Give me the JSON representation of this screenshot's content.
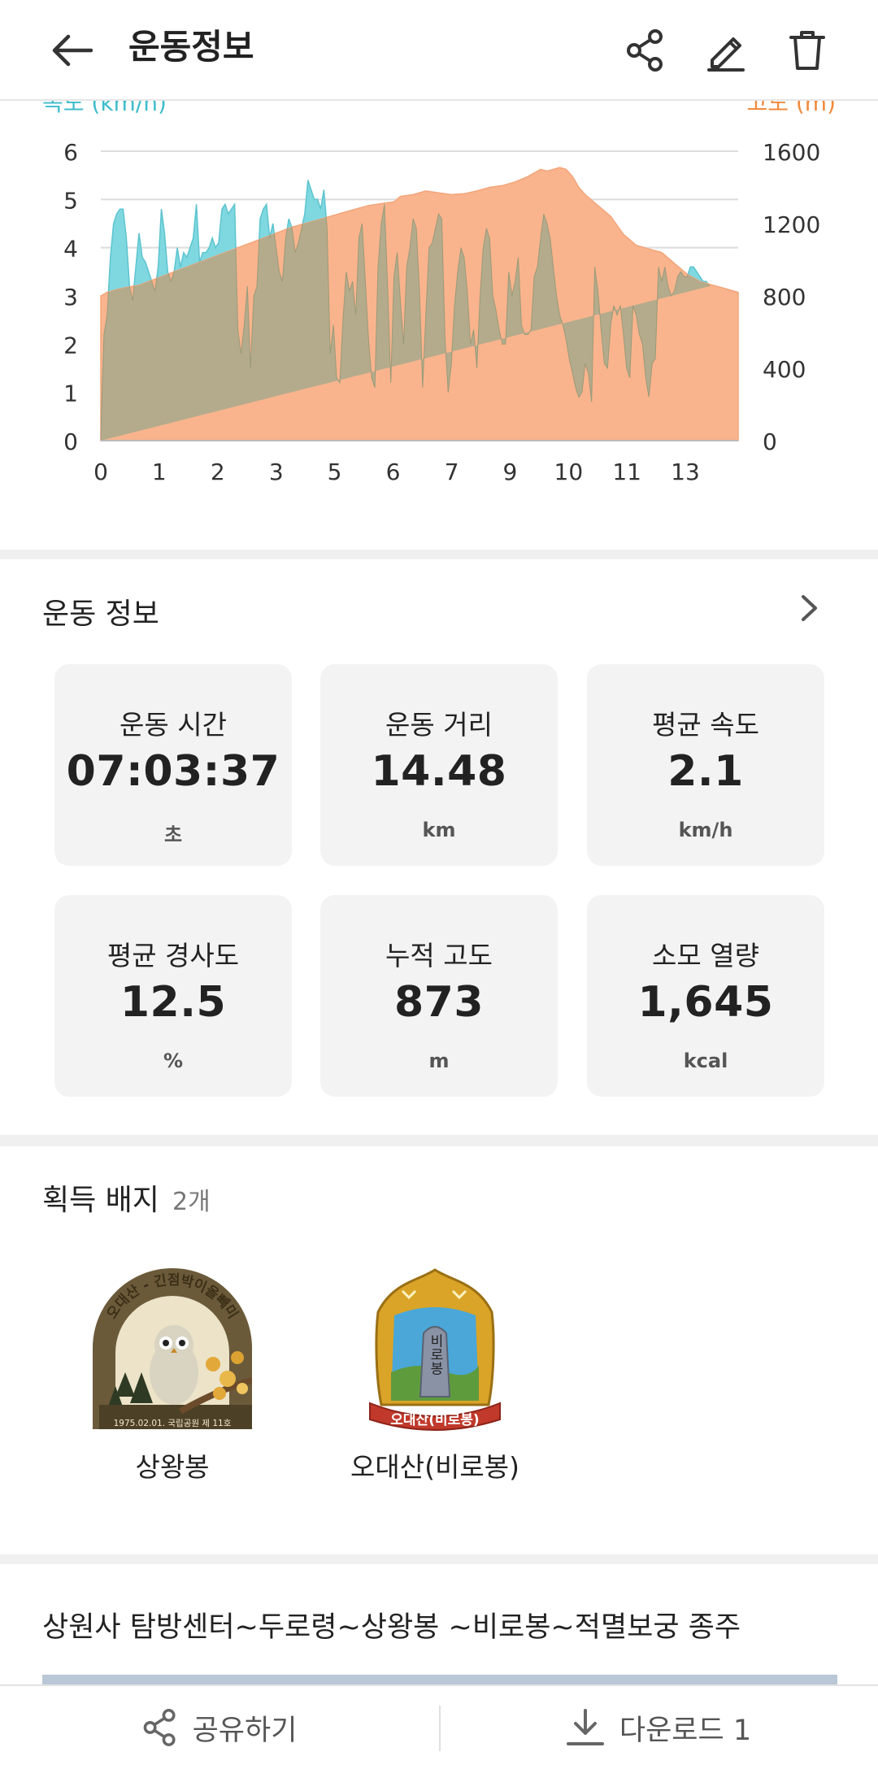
{
  "header": {
    "title": "운동정보",
    "icons": [
      "back-arrow-icon",
      "share-icon",
      "edit-icon",
      "trash-icon"
    ]
  },
  "chart_data": {
    "type": "area",
    "left_axis_label": "속도 (km/h)",
    "right_axis_label": "고도 (m)",
    "x_ticks": [
      "0",
      "1",
      "2",
      "3",
      "5",
      "6",
      "7",
      "9",
      "10",
      "11",
      "13"
    ],
    "x_tick_fracs": [
      0,
      0.0915,
      0.1834,
      0.2752,
      0.3667,
      0.4586,
      0.5506,
      0.6421,
      0.7339,
      0.8255,
      0.9171
    ],
    "y_left_ticks": [
      0,
      1,
      2,
      3,
      4,
      5,
      6
    ],
    "y_right_ticks": [
      0,
      400,
      800,
      1200,
      1600
    ],
    "ylim_left": [
      0,
      6
    ],
    "ylim_right": [
      0,
      1600
    ],
    "colors": {
      "speed": "#7fd8e0",
      "altitude": "#f9b48d",
      "overlap": "#b4ab8c"
    },
    "series": [
      {
        "name": "고도 (m)",
        "axis": "right",
        "x_frac": [
          0,
          0.01,
          0.03,
          0.06,
          0.09,
          0.12,
          0.15,
          0.18,
          0.21,
          0.24,
          0.27,
          0.3,
          0.33,
          0.36,
          0.39,
          0.42,
          0.44,
          0.46,
          0.47,
          0.49,
          0.51,
          0.53,
          0.55,
          0.57,
          0.59,
          0.61,
          0.63,
          0.65,
          0.67,
          0.69,
          0.7,
          0.71,
          0.72,
          0.73,
          0.74,
          0.75,
          0.76,
          0.78,
          0.8,
          0.82,
          0.84,
          0.86,
          0.88,
          0.9,
          0.92,
          0.94,
          0.96,
          0.98,
          1.0
        ],
        "values": [
          800,
          820,
          840,
          860,
          900,
          940,
          980,
          1020,
          1060,
          1100,
          1140,
          1180,
          1210,
          1240,
          1270,
          1300,
          1310,
          1320,
          1350,
          1360,
          1380,
          1370,
          1360,
          1365,
          1380,
          1400,
          1410,
          1430,
          1460,
          1500,
          1490,
          1500,
          1510,
          1500,
          1460,
          1400,
          1360,
          1300,
          1240,
          1140,
          1080,
          1060,
          1040,
          980,
          920,
          880,
          860,
          840,
          820
        ]
      },
      {
        "name": "속도 (km/h)",
        "axis": "left",
        "x_frac": [
          0,
          0.005,
          0.01,
          0.015,
          0.02,
          0.025,
          0.03,
          0.035,
          0.04,
          0.045,
          0.05,
          0.055,
          0.06,
          0.065,
          0.07,
          0.075,
          0.08,
          0.085,
          0.09,
          0.095,
          0.1,
          0.105,
          0.11,
          0.115,
          0.12,
          0.125,
          0.13,
          0.135,
          0.14,
          0.145,
          0.15,
          0.155,
          0.16,
          0.165,
          0.17,
          0.175,
          0.18,
          0.185,
          0.19,
          0.195,
          0.2,
          0.205,
          0.21,
          0.215,
          0.22,
          0.225,
          0.23,
          0.235,
          0.24,
          0.245,
          0.25,
          0.255,
          0.26,
          0.265,
          0.27,
          0.275,
          0.28,
          0.285,
          0.29,
          0.295,
          0.3,
          0.305,
          0.31,
          0.315,
          0.32,
          0.325,
          0.33,
          0.335,
          0.34,
          0.345,
          0.35,
          0.355,
          0.36,
          0.365,
          0.37,
          0.375,
          0.38,
          0.385,
          0.39,
          0.395,
          0.4,
          0.405,
          0.41,
          0.415,
          0.42,
          0.425,
          0.43,
          0.435,
          0.44,
          0.445,
          0.45,
          0.455,
          0.46,
          0.465,
          0.47,
          0.475,
          0.48,
          0.485,
          0.49,
          0.495,
          0.5,
          0.505,
          0.51,
          0.515,
          0.52,
          0.525,
          0.53,
          0.535,
          0.54,
          0.545,
          0.55,
          0.555,
          0.56,
          0.565,
          0.57,
          0.575,
          0.58,
          0.585,
          0.59,
          0.595,
          0.6,
          0.605,
          0.61,
          0.615,
          0.62,
          0.625,
          0.63,
          0.635,
          0.64,
          0.645,
          0.65,
          0.655,
          0.66,
          0.665,
          0.67,
          0.675,
          0.68,
          0.685,
          0.69,
          0.695,
          0.7,
          0.705,
          0.71,
          0.715,
          0.72,
          0.725,
          0.73,
          0.735,
          0.74,
          0.745,
          0.75,
          0.755,
          0.76,
          0.765,
          0.77,
          0.775,
          0.78,
          0.785,
          0.79,
          0.795,
          0.8,
          0.805,
          0.81,
          0.815,
          0.82,
          0.825,
          0.83,
          0.835,
          0.84,
          0.845,
          0.85,
          0.855,
          0.86,
          0.865,
          0.87,
          0.875,
          0.88,
          0.885,
          0.89,
          0.895,
          0.9,
          0.905,
          0.91,
          0.915,
          0.92,
          0.925,
          0.93,
          0.935,
          0.94,
          0.945,
          0.95,
          0.955,
          0.96,
          0.965,
          0.97,
          0.975,
          0.98,
          0.985,
          0.99,
          0.995,
          1.0
        ],
        "values": [
          0.2,
          2.2,
          2.6,
          3.8,
          4.5,
          4.7,
          4.8,
          4.8,
          4.2,
          3.2,
          2.9,
          3.6,
          4.3,
          3.8,
          3.7,
          3.5,
          3.3,
          3.1,
          3.6,
          4.8,
          4.3,
          3.5,
          3.3,
          3.5,
          4.0,
          3.6,
          3.9,
          3.8,
          4.0,
          4.2,
          4.9,
          3.7,
          3.9,
          3.9,
          4.0,
          4.2,
          4.0,
          4.1,
          4.8,
          4.9,
          4.7,
          4.8,
          4.9,
          2.3,
          1.8,
          2.4,
          3.2,
          1.5,
          3.0,
          3.2,
          4.6,
          4.8,
          4.9,
          4.2,
          4.5,
          4.0,
          3.5,
          3.3,
          4.2,
          4.6,
          4.4,
          3.9,
          4.1,
          4.4,
          4.7,
          5.4,
          5.2,
          5.0,
          5.0,
          4.8,
          5.2,
          4.4,
          1.8,
          2.4,
          1.3,
          1.2,
          2.5,
          3.5,
          3.1,
          3.3,
          2.6,
          4.2,
          4.5,
          3.3,
          2.1,
          1.3,
          1.1,
          3.6,
          4.5,
          4.9,
          3.2,
          1.2,
          3.4,
          3.9,
          2.9,
          2.0,
          3.6,
          4.0,
          4.6,
          4.4,
          3.1,
          1.1,
          2.6,
          4.0,
          4.1,
          4.4,
          4.7,
          4.6,
          2.1,
          1.0,
          1.6,
          2.8,
          3.5,
          4.0,
          3.8,
          3.1,
          2.0,
          2.3,
          1.5,
          3.0,
          4.0,
          4.4,
          4.2,
          3.0,
          2.7,
          2.3,
          2.0,
          2.0,
          3.5,
          3.0,
          3.3,
          3.8,
          2.4,
          2.2,
          2.2,
          2.3,
          3.4,
          3.6,
          4.2,
          4.7,
          4.5,
          4.2,
          3.6,
          3.0,
          2.6,
          2.4,
          2.1,
          1.7,
          1.4,
          1.1,
          0.9,
          1.0,
          1.6,
          1.4,
          0.8,
          3.6,
          3.1,
          2.3,
          1.6,
          1.5,
          2.4,
          2.8,
          2.6,
          2.8,
          2.2,
          1.5,
          1.3,
          2.8,
          2.6,
          2.2,
          2.0,
          1.3,
          0.9,
          1.6,
          1.7,
          3.6,
          3.3,
          3.6,
          3.2,
          3.0,
          3.1,
          3.4,
          3.5,
          3.4,
          3.4,
          3.6,
          3.6,
          3.5,
          3.4,
          3.3,
          3.3,
          3.2
        ]
      }
    ]
  },
  "stats": {
    "title": "운동 정보",
    "items": [
      {
        "label": "운동 시간",
        "value": "07:03:37",
        "unit": "초"
      },
      {
        "label": "운동 거리",
        "value": "14.48",
        "unit": "km"
      },
      {
        "label": "평균 속도",
        "value": "2.1",
        "unit": "km/h"
      },
      {
        "label": "평균 경사도",
        "value": "12.5",
        "unit": "%"
      },
      {
        "label": "누적 고도",
        "value": "873",
        "unit": "m"
      },
      {
        "label": "소모 열량",
        "value": "1,645",
        "unit": "kcal"
      }
    ]
  },
  "badges": {
    "title": "획득 배지",
    "count": "2개",
    "items": [
      {
        "name": "상왕봉",
        "arc_text": "오대산 - 긴점박이올빼미",
        "footer_text": "1975.02.01. 국립공원 제 11호",
        "colors": {
          "bg": "#6b5a3a",
          "sky": "#e9dfc5",
          "owl": "#d9d4c2",
          "leaves": "#e2a83a"
        }
      },
      {
        "name": "오대산(비로봉)",
        "stone_text": "비로봉",
        "ribbon_text": "오대산(비로봉)",
        "colors": {
          "gold": "#d9a428",
          "sky": "#4aa7d8",
          "grass": "#5e9b3d",
          "ribbon": "#c0392b"
        }
      }
    ]
  },
  "course": {
    "title": "상원사 탐방센터~두로령~상왕봉 ~비로봉~적멸보궁 종주"
  },
  "bottom_bar": {
    "share_label": "공유하기",
    "download_label": "다운로드 1"
  }
}
